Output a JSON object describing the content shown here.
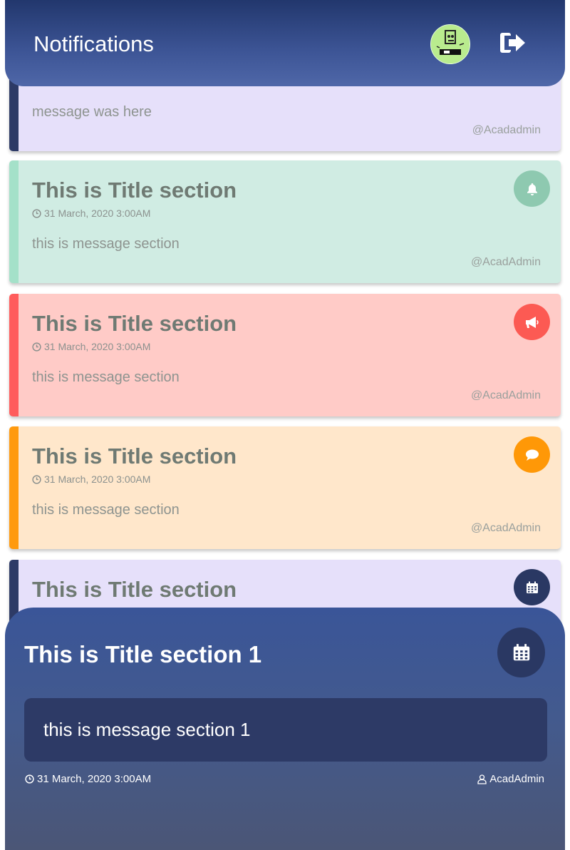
{
  "header": {
    "title": "Notifications",
    "avatar_alt": "user avatar",
    "logout_icon": "sign-out-icon"
  },
  "first_card": {
    "message": "message was here",
    "author": "@Acadadmin",
    "color": "#e6e0fa",
    "stripe": "#2d3a66"
  },
  "cards": [
    {
      "title": "This is Title section",
      "date": "31 March, 2020 3:00AM",
      "message": "this is message section",
      "author": "@AcadAdmin",
      "icon": "bell-icon",
      "bg": "#d0ece3",
      "stripe": "#a4e1c9",
      "badge": "#8ec9b0"
    },
    {
      "title": "This is Title section",
      "date": "31 March, 2020 3:00AM",
      "message": "this is message section",
      "author": "@AcadAdmin",
      "icon": "megaphone-icon",
      "bg": "#ffcbc7",
      "stripe": "#ff5c5c",
      "badge": "#fc5a53"
    },
    {
      "title": "This is Title section",
      "date": "31 March, 2020 3:00AM",
      "message": "this is message section",
      "author": "@AcadAdmin",
      "icon": "comment-icon",
      "bg": "#ffe7cb",
      "stripe": "#ff9a0e",
      "badge": "#ff9807"
    },
    {
      "title": "This is Title section",
      "icon": "calendar-icon",
      "bg": "#e6e0fa",
      "stripe": "#2d3a66",
      "badge": "#2a3863"
    }
  ],
  "detail_sheet": {
    "title": "This is Title section 1",
    "message": "this is message section 1",
    "date": "31 March, 2020 3:00AM",
    "author": "AcadAdmin",
    "icon": "calendar-icon"
  }
}
